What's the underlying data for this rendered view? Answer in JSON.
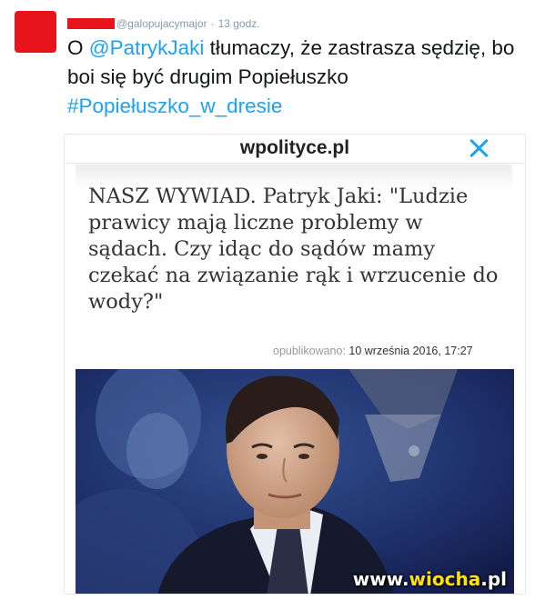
{
  "tweet": {
    "handle": "@galopujacymajor",
    "separator": "·",
    "time": "13 godz.",
    "text_before": "O ",
    "mention": "@PatrykJaki",
    "text_main": " tłumaczy, że zastrasza sędzię, bo boi się być drugim Popiełuszko",
    "hashtag": "#Popiełuszko_w_dresie"
  },
  "card": {
    "site": "wpolityce.pl",
    "headline": "NASZ WYWIAD. Patryk Jaki: \"Ludzie prawicy mają liczne problemy w sądach. Czy idąc do sądów mamy czekać na związanie rąk i wrzucenie do wody?\"",
    "published_label": "opublikowano:",
    "published_date": "10 września 2016, 17:27"
  },
  "watermark": {
    "prefix": "www.",
    "accent": "wiocha",
    "suffix": ".pl"
  },
  "colors": {
    "link": "#1da1f2",
    "redaction": "#e8141c",
    "photo_background": "#1c2c69"
  }
}
